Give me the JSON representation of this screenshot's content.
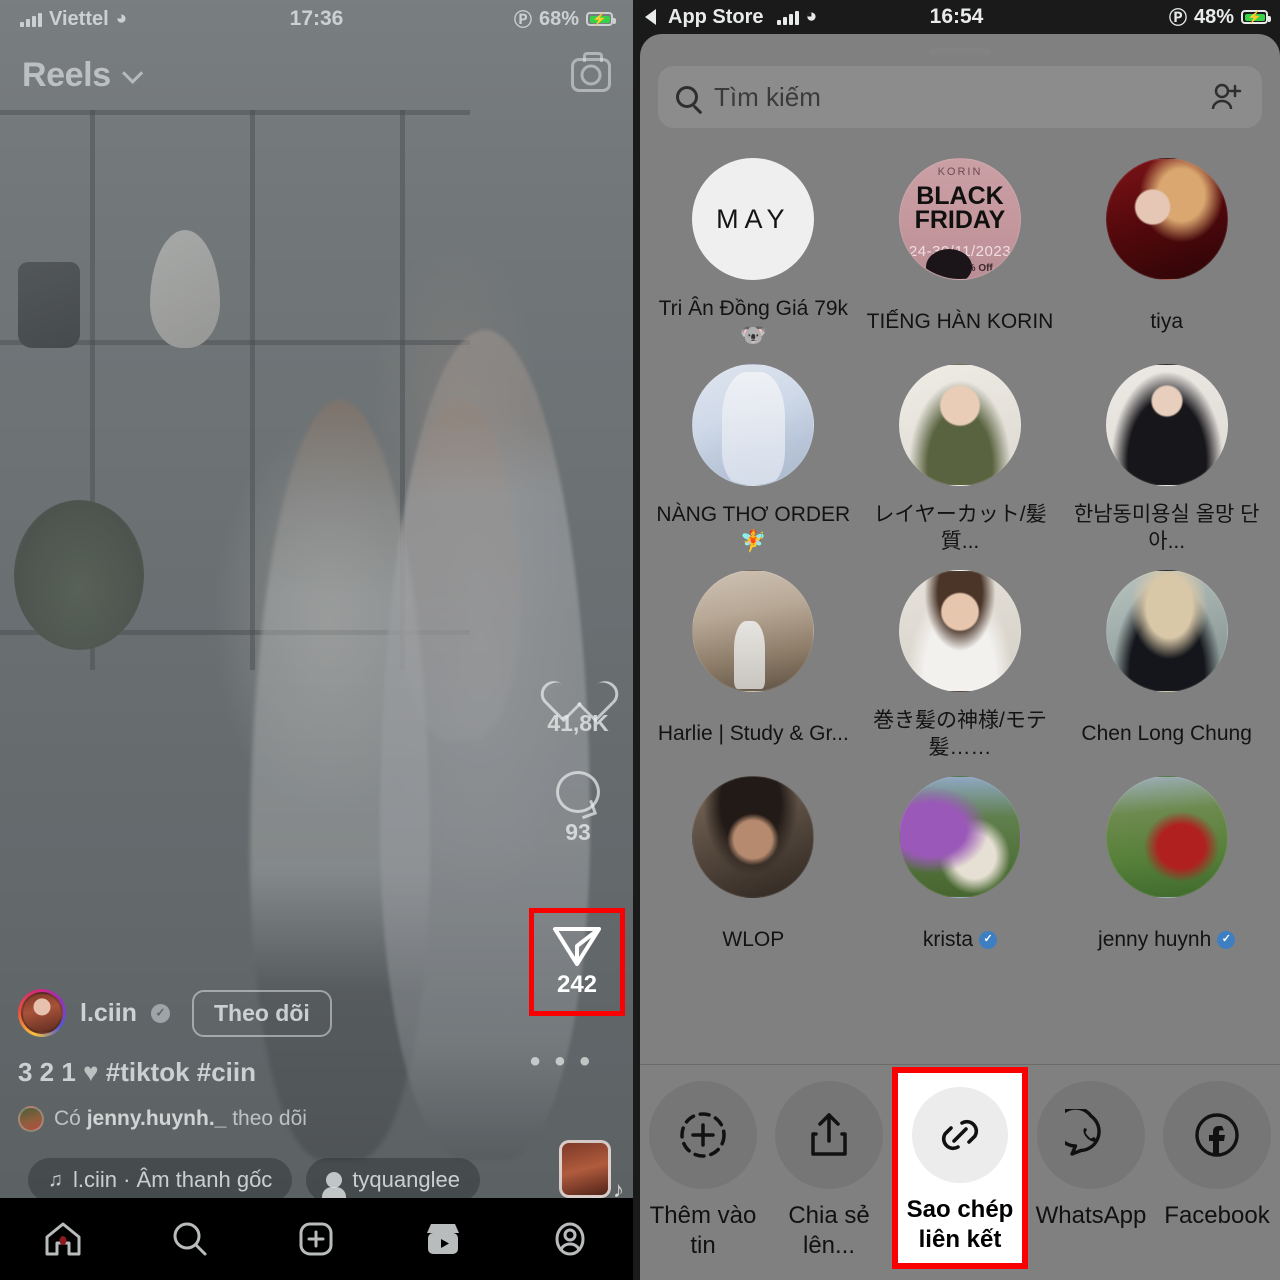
{
  "left_panel": {
    "status_bar": {
      "carrier": "Viettel",
      "time": "17:36",
      "battery": "68%"
    },
    "header": {
      "title": "Reels",
      "camera_icon": "camera-icon",
      "chevron_icon": "chevron-down-icon"
    },
    "rail": {
      "like_count": "41,8K",
      "comment_count": "93",
      "share_count": "242",
      "more_label": "• • •"
    },
    "meta": {
      "username": "l.ciin",
      "follow_label": "Theo dõi",
      "caption": "3 2 1 🤍 #tiktok #ciin",
      "caption_prefix": "3 2 1",
      "caption_heart": "♥",
      "caption_tags": "#tiktok #ciin",
      "followed_by_prefix": "Có",
      "followed_by_user": "jenny.huynh._",
      "followed_by_suffix": "theo dõi"
    },
    "audio": {
      "track": "l.ciin · Âm thanh gốc",
      "tagged_user": "tyquanglee"
    },
    "tabbar": [
      "home-icon",
      "search-icon",
      "create-icon",
      "reels-icon",
      "profile-icon"
    ]
  },
  "right_panel": {
    "status_bar": {
      "back_label": "App Store",
      "time": "16:54",
      "battery": "48%"
    },
    "search": {
      "placeholder": "Tìm kiếm",
      "search_icon": "search-icon",
      "add_people_icon": "add-people-icon"
    },
    "contacts": [
      {
        "name": "Tri Ân Đồng Giá 79k 🐨",
        "avatar": "may-logo",
        "verified": false
      },
      {
        "name": "TIẾNG HÀN KORIN",
        "avatar": "black-friday-banner",
        "verified": false
      },
      {
        "name": "tiya",
        "avatar": "woman-red-photo",
        "verified": false
      },
      {
        "name": "NÀNG THƠ ORDER 🧚",
        "avatar": "white-dress-photo",
        "verified": false
      },
      {
        "name": "レイヤーカット/髪質...",
        "avatar": "woman-green-shirt-photo",
        "verified": false
      },
      {
        "name": "한남동미용실 올망 단아...",
        "avatar": "woman-black-outfit-photo",
        "verified": false
      },
      {
        "name": "Harlie | Study & Gr...",
        "avatar": "cafe-interior-photo",
        "verified": false
      },
      {
        "name": "巻き髪の神様/モテ髪……",
        "avatar": "man-white-shirt-photo",
        "verified": false
      },
      {
        "name": "Chen Long Chung",
        "avatar": "illustrated-portrait",
        "verified": false
      },
      {
        "name": "WLOP",
        "avatar": "digital-art-portrait",
        "verified": false
      },
      {
        "name": "krista",
        "avatar": "flowers-garden-photo",
        "verified": true
      },
      {
        "name": "jenny huynh",
        "avatar": "woman-red-dress-photo",
        "verified": true
      }
    ],
    "actions": [
      {
        "label": "Thêm vào tin",
        "icon": "add-to-story-icon",
        "highlighted": false
      },
      {
        "label": "Chia sẻ lên...",
        "icon": "share-up-icon",
        "highlighted": false
      },
      {
        "label": "Sao chép liên kết",
        "icon": "link-icon",
        "highlighted": true
      },
      {
        "label": "WhatsApp",
        "icon": "whatsapp-icon",
        "highlighted": false
      },
      {
        "label": "Facebook",
        "icon": "facebook-icon",
        "highlighted": false
      }
    ]
  },
  "annotations": {
    "highlight_color": "#fb0000"
  }
}
